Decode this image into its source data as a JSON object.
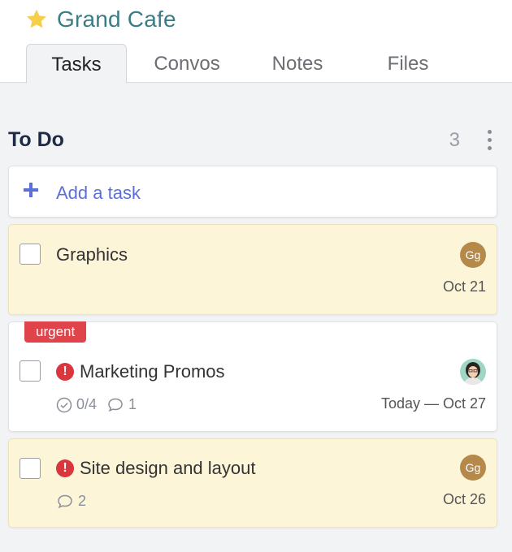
{
  "header": {
    "title": "Grand Cafe",
    "star_icon": "star-icon"
  },
  "tabs": [
    {
      "label": "Tasks",
      "active": true
    },
    {
      "label": "Convos",
      "active": false
    },
    {
      "label": "Notes",
      "active": false
    },
    {
      "label": "Files",
      "active": false
    }
  ],
  "section": {
    "title": "To Do",
    "count": "3"
  },
  "add_task": {
    "label": "Add a task"
  },
  "tasks": [
    {
      "title": "Graphics",
      "assignee_initials": "Gg",
      "date": "Oct 21",
      "highlight": true
    },
    {
      "badge": "urgent",
      "title": "Marketing Promos",
      "priority": "high",
      "checklist": "0/4",
      "comments": "1",
      "date": "Today — Oct 27",
      "highlight": false
    },
    {
      "title": "Site design and layout",
      "priority": "high",
      "assignee_initials": "Gg",
      "comments": "2",
      "date": "Oct 26",
      "highlight": true
    }
  ],
  "colors": {
    "accent": "#5b6fd8",
    "title": "#3a7d85",
    "urgent": "#e0444b",
    "highlight_card": "#fdf5d8",
    "avatar": "#b5894a"
  }
}
